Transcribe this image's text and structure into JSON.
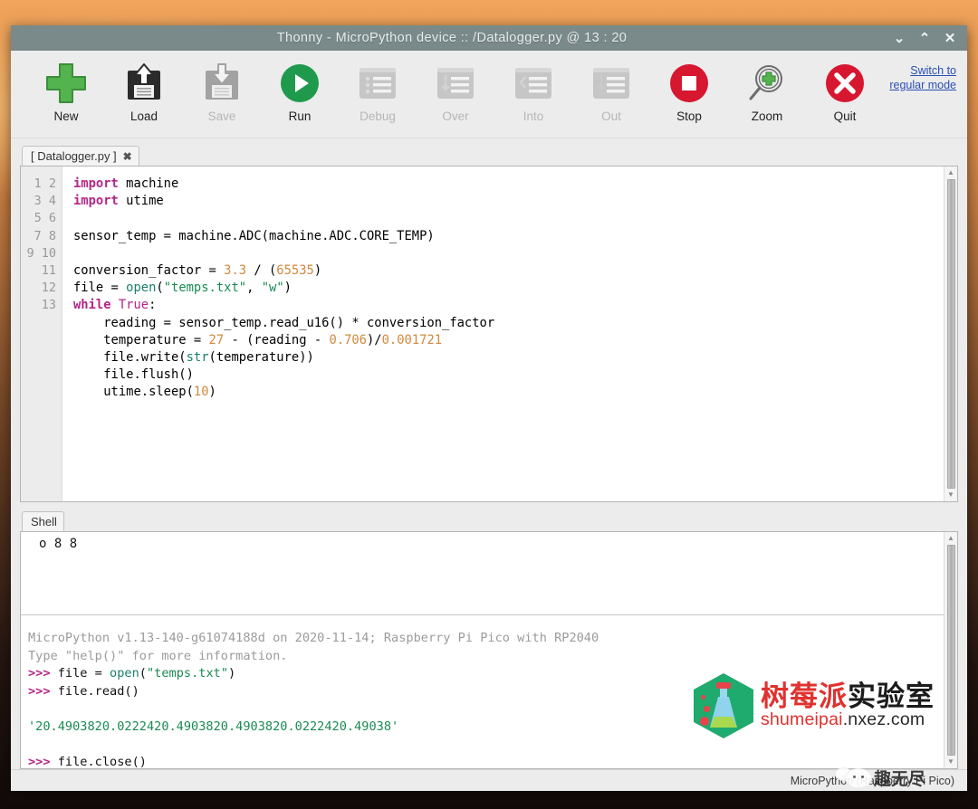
{
  "window": {
    "title": "Thonny  -  MicroPython device :: /Datalogger.py  @  13 : 20",
    "minimize": "⌄",
    "maximize": "⌃",
    "close": "✕"
  },
  "toolbar": {
    "buttons": [
      {
        "label": "New",
        "icon": "plus-icon",
        "enabled": true
      },
      {
        "label": "Load",
        "icon": "floppy-up-icon",
        "enabled": true
      },
      {
        "label": "Save",
        "icon": "floppy-down-icon",
        "enabled": false
      },
      {
        "label": "Run",
        "icon": "play-icon",
        "enabled": true
      },
      {
        "label": "Debug",
        "icon": "debug-icon",
        "enabled": false
      },
      {
        "label": "Over",
        "icon": "step-over-icon",
        "enabled": false
      },
      {
        "label": "Into",
        "icon": "step-into-icon",
        "enabled": false
      },
      {
        "label": "Out",
        "icon": "step-out-icon",
        "enabled": false
      },
      {
        "label": "Stop",
        "icon": "stop-icon",
        "enabled": true
      },
      {
        "label": "Zoom",
        "icon": "magnifier-icon",
        "enabled": true
      },
      {
        "label": "Quit",
        "icon": "x-circle-icon",
        "enabled": true
      }
    ],
    "switch_link": "Switch to regular mode"
  },
  "editor": {
    "tab_label": "[ Datalogger.py ]",
    "tab_close": "✖",
    "line_numbers": [
      "1",
      "2",
      "3",
      "4",
      "5",
      "6",
      "7",
      "8",
      "9",
      "10",
      "11",
      "12",
      "13"
    ]
  },
  "shell": {
    "tab_label": "Shell",
    "top_lines": [
      "o",
      "8",
      "8"
    ],
    "banner_line1": "MicroPython v1.13-140-g61074188d on 2020-11-14; Raspberry Pi Pico with RP2040",
    "banner_line2": "Type \"help()\" for more information.",
    "prompt": ">>>",
    "cmd1": "file = open(\"temps.txt\")",
    "cmd2": "file.read()",
    "output": "'20.4903820.0222420.4903820.4903820.0222420.49038'",
    "cmd3": "file.close()"
  },
  "statusbar": {
    "interpreter": "MicroPython (Raspberry Pi Pico)"
  },
  "watermark": {
    "brand_cn_red": "树莓派",
    "brand_cn_black": "实验室",
    "url_red": "shumeipai",
    "url_black": ".nxez.com",
    "badge_cn": "趣无尽"
  },
  "colors": {
    "accent_green": "#37a34a",
    "accent_red": "#d6283a",
    "titlebar": "#7a8a8a",
    "link": "#2b4fb5"
  }
}
